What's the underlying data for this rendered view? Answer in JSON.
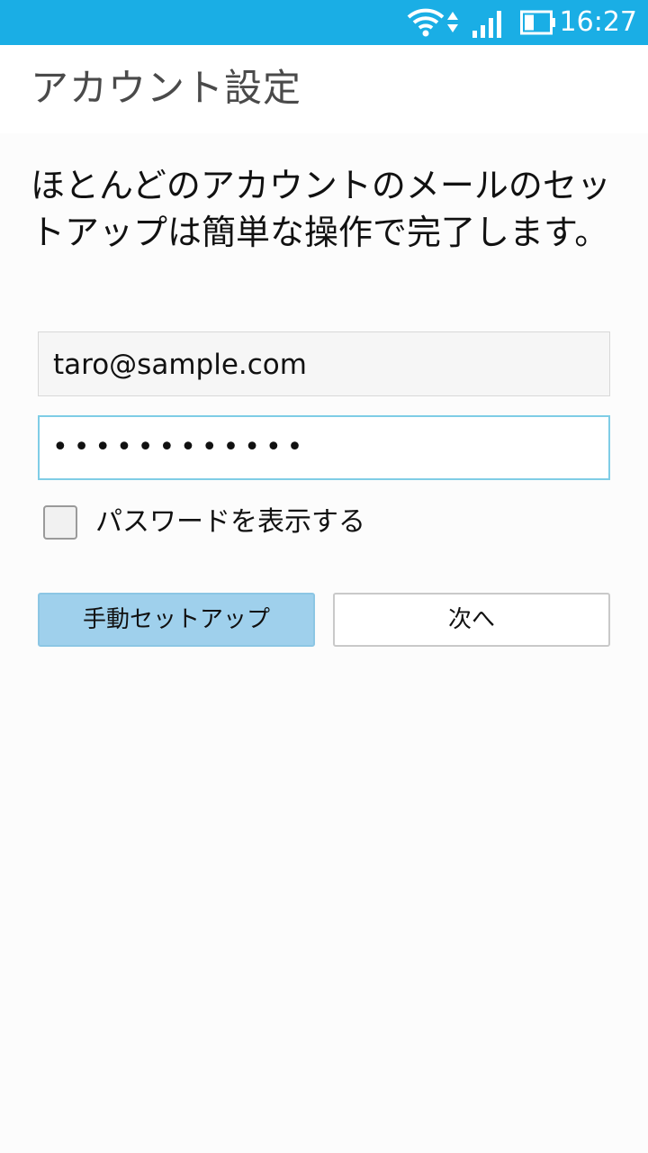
{
  "status_bar": {
    "time": "16:27",
    "background_color": "#1aaee5",
    "icons": [
      "wifi-icon",
      "data-updown-icon",
      "signal-icon",
      "battery-icon"
    ]
  },
  "header": {
    "title": "アカウント設定"
  },
  "intro": {
    "text": "ほとんどのアカウントのメールのセットアップは簡単な操作で完了します。"
  },
  "form": {
    "email_value": "taro@sample.com",
    "password_masked": "••••••••••••",
    "show_password_label": "パスワードを表示する",
    "show_password_checked": false
  },
  "actions": {
    "manual_setup_label": "手動セットアップ",
    "next_label": "次へ",
    "accent_color": "#9fd0ec"
  }
}
